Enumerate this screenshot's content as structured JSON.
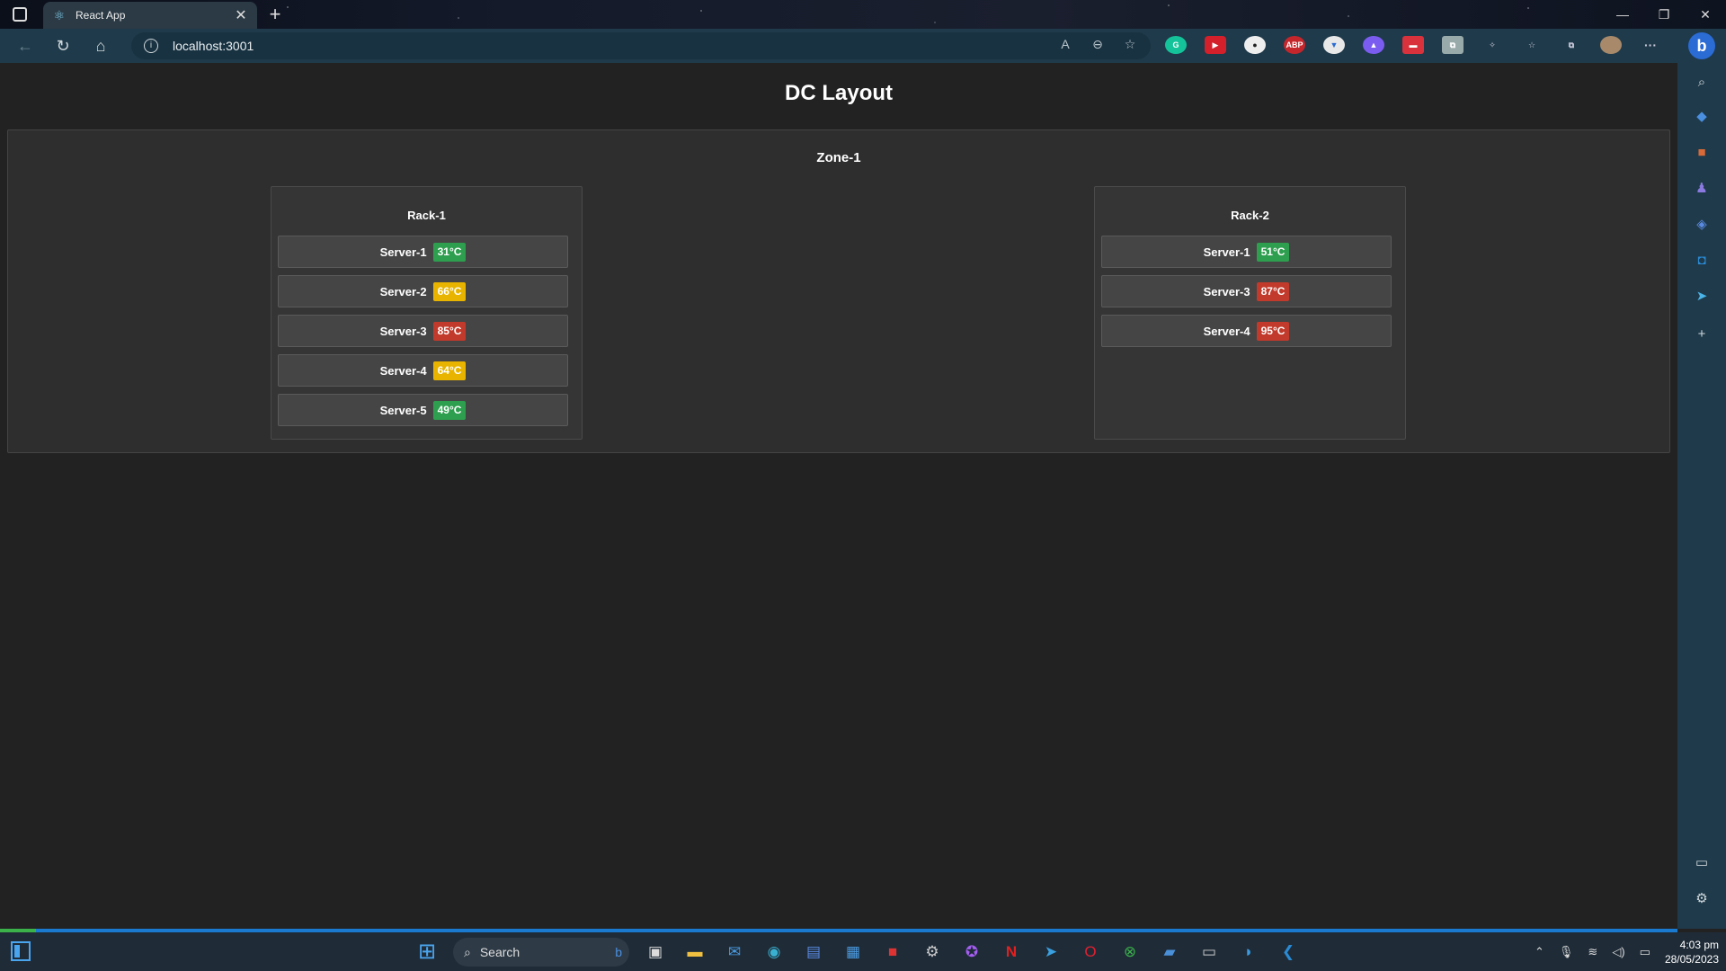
{
  "browser": {
    "tab_title": "React App",
    "url": "localhost:3001",
    "tab_close_glyph": "✕",
    "new_tab_glyph": "+"
  },
  "page": {
    "title": "DC Layout",
    "zone": {
      "name": "Zone-1",
      "racks": [
        {
          "name": "Rack-1",
          "servers": [
            {
              "name": "Server-1",
              "temp": "31°C",
              "status": "ok"
            },
            {
              "name": "Server-2",
              "temp": "66°C",
              "status": "warn"
            },
            {
              "name": "Server-3",
              "temp": "85°C",
              "status": "hot"
            },
            {
              "name": "Server-4",
              "temp": "64°C",
              "status": "warn"
            },
            {
              "name": "Server-5",
              "temp": "49°C",
              "status": "ok"
            }
          ]
        },
        {
          "name": "Rack-2",
          "servers": [
            {
              "name": "Server-1",
              "temp": "51°C",
              "status": "ok"
            },
            {
              "name": "Server-3",
              "temp": "87°C",
              "status": "hot"
            },
            {
              "name": "Server-4",
              "temp": "95°C",
              "status": "hot"
            }
          ]
        }
      ]
    }
  },
  "colors": {
    "ok": "#2e9e4f",
    "warn": "#e8b400",
    "hot": "#c23a2b"
  },
  "taskbar": {
    "search_placeholder": "Search",
    "time": "4:03 pm",
    "date": "28/05/2023"
  }
}
